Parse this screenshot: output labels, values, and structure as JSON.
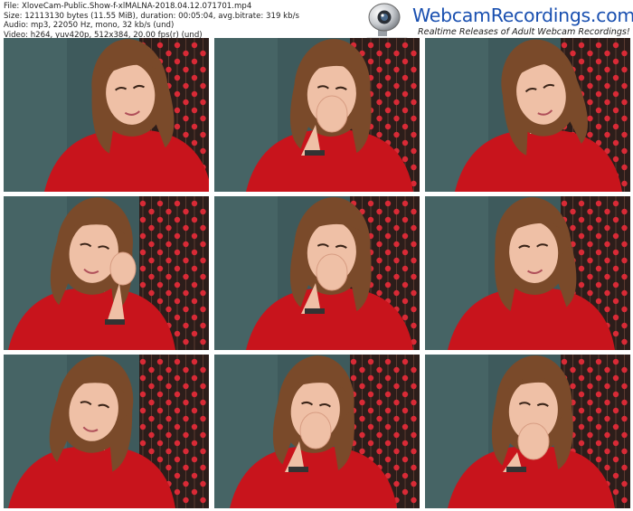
{
  "file_info": {
    "file": "File: XloveCam-Public.Show-f-xlMALNA-2018.04.12.071701.mp4",
    "size": "Size: 12113130 bytes (11.55 MiB), duration: 00:05:04, avg.bitrate: 319 kb/s",
    "audio": "Audio: mp3, 22050 Hz, mono, 32 kb/s (und)",
    "video": "Video: h264, yuv420p, 512x384, 20.00 fps(r) (und)"
  },
  "logo": {
    "icon": "webcam-icon",
    "brand": "WebcamRecordings.com",
    "tagline": "Realtime Releases of Adult Webcam Recordings!"
  },
  "colors": {
    "brand": "#1a50b0",
    "top_background": "#3e5a5c",
    "curtain": "#2c1d1a",
    "flower_red": "#d92a36",
    "sweater_red": "#c8141c",
    "hair": "#7a4a2a",
    "skin": "#efc0a6"
  },
  "thumbnails": [
    {
      "pose": "smiling-looking-down"
    },
    {
      "pose": "hand-over-mouth"
    },
    {
      "pose": "smiling-head-tilt"
    },
    {
      "pose": "profile-hand-in-hair"
    },
    {
      "pose": "hand-over-mouth"
    },
    {
      "pose": "looking-down-smile"
    },
    {
      "pose": "laughing-head-tilt"
    },
    {
      "pose": "hand-over-mouth-looking-down"
    },
    {
      "pose": "hand-on-chin-looking-down"
    }
  ]
}
